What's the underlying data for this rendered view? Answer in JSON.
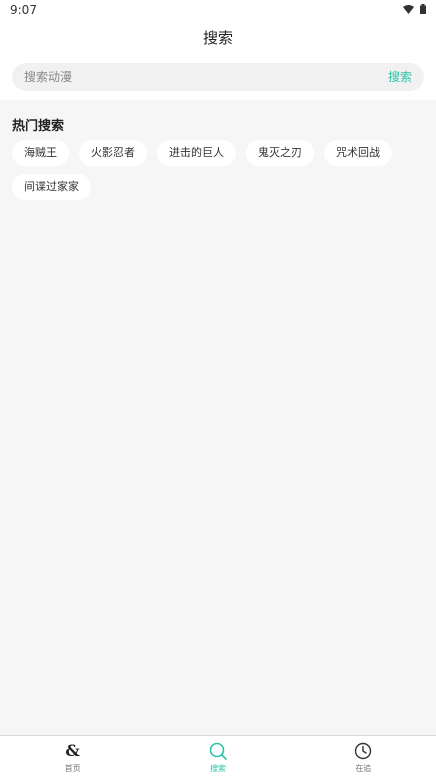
{
  "status_bar": {
    "time": "9:07"
  },
  "header": {
    "title": "搜索"
  },
  "search": {
    "placeholder": "搜索动漫",
    "value": "",
    "button_label": "搜索"
  },
  "hot": {
    "title": "热门搜索",
    "tags": [
      "海贼王",
      "火影忍者",
      "进击的巨人",
      "鬼灭之刃",
      "咒术回战",
      "间谍过家家"
    ]
  },
  "bottom_nav": {
    "items": [
      {
        "label": "首页",
        "icon": "home-logo-icon",
        "active": false
      },
      {
        "label": "搜索",
        "icon": "search-icon",
        "active": true
      },
      {
        "label": "在追",
        "icon": "clock-icon",
        "active": false
      }
    ]
  },
  "colors": {
    "accent": "#2dc3a8",
    "background": "#f6f6f6",
    "surface": "#ffffff"
  }
}
